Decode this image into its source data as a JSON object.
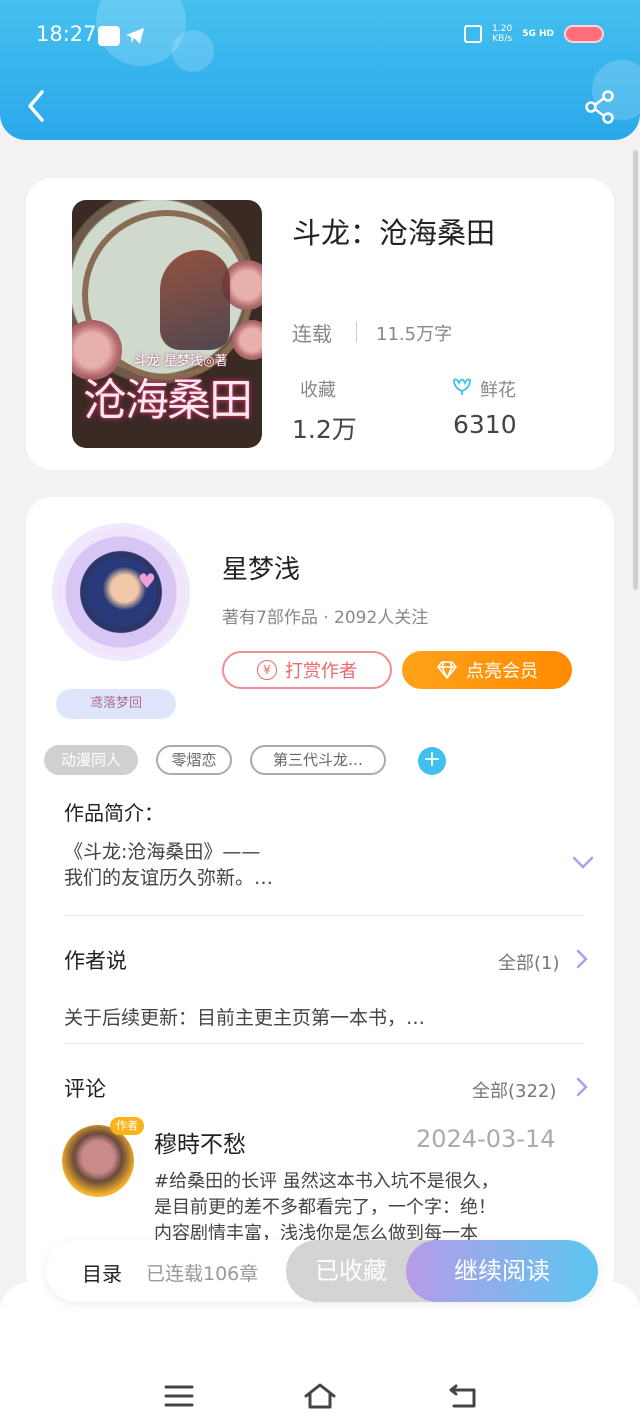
{
  "status_bar": {
    "time": "18:27",
    "net_speed_value": "1.20",
    "net_speed_unit": "KB/s",
    "signal": "5G HD"
  },
  "header": {
    "back_icon": "back-arrow-icon",
    "share_icon": "share-icon"
  },
  "book": {
    "title": "斗龙：沧海桑田",
    "cover_title": "沧海桑田",
    "cover_subtitle": "斗龙 星梦浅◎著",
    "status": "连载",
    "word_count": "11.5万字",
    "collect_label": "收藏",
    "collect_value": "1.2万",
    "flower_label": "鲜花",
    "flower_value": "6310"
  },
  "author": {
    "name": "星梦浅",
    "meta": "著有7部作品 · 2092人关注",
    "badge": "鸢落梦回",
    "reward_label": "打赏作者",
    "vip_label": "点亮会员",
    "reward_icon": "yen",
    "tags": [
      "动漫同人",
      "零熠恋",
      "第三代斗龙…"
    ],
    "add_tag": "+"
  },
  "intro": {
    "title": "作品简介：",
    "line1": "《斗龙:沧海桑田》——",
    "line2": "我们的友谊历久弥新。…"
  },
  "author_say": {
    "title": "作者说",
    "more": "全部(1)",
    "text": "关于后续更新：目前主更主页第一本书，…"
  },
  "comments": {
    "title": "评论",
    "more": "全部(322)",
    "items": [
      {
        "user": "穆時不愁",
        "badge": "作者",
        "date": "2024-03-14",
        "line1": "#给桑田的长评  虽然这本书入坑不是很久，",
        "line2": "是目前更的差不多都看完了，一个字：绝！",
        "line3": "内容剧情丰富，浅浅你是怎么做到每一本"
      }
    ]
  },
  "action_bar": {
    "toc": "目录",
    "chapters": "已连载106章",
    "fav": "已收藏",
    "read": "继续阅读"
  }
}
